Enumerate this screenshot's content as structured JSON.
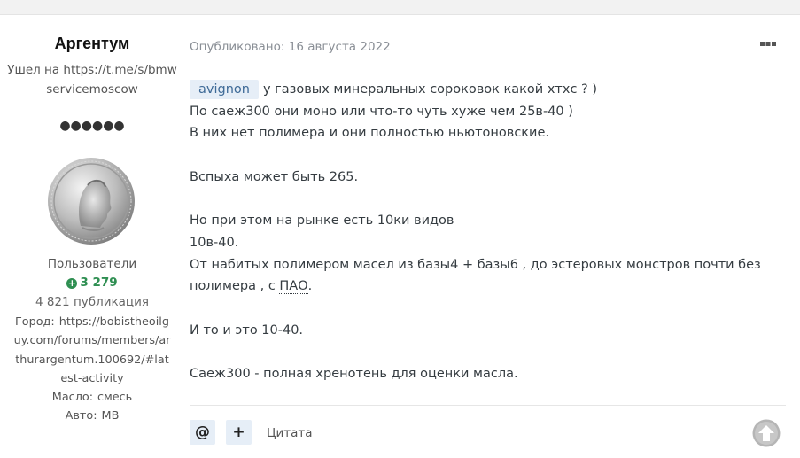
{
  "author": {
    "name": "Аргентум",
    "title": "Ушел на https://t.me/s/bmwservicemoscow",
    "rank_dots": "●●●●●●",
    "group": "Пользователи",
    "reputation": "3 279",
    "posts": "4 821 публикация",
    "fields": [
      {
        "label": "Город:",
        "value": "https://bobistheoilguy.com/forums/members/arthurargentum.100692/#latest-activity"
      },
      {
        "label": "Масло:",
        "value": "смесь"
      },
      {
        "label": "Авто:",
        "value": "MB"
      }
    ]
  },
  "post": {
    "published": "Опубликовано: 16 августа 2022",
    "mention": "avignon",
    "line1": "у газовых минеральных сороковок какой хтхс ? )",
    "line2": "По саеж300 они моно или что-то чуть хуже чем 25в-40 )",
    "line3": "В них нет полимера и они полностью ньютоновские.",
    "line4": "Вспыха может быть 265.",
    "line5": "Но при этом на рынке есть 10ки видов",
    "line6": "10в-40.",
    "line7": "От набитых полимером масел из базы4 + базы6 , до эстеровых монстров почти без",
    "line8_pre": "полимера , с ",
    "line8_abbr": "ПАО",
    "line8_post": ".",
    "line9": "И то и это 10-40.",
    "line10": "Саеж300 - полная хренотень для оценки масла."
  },
  "actions": {
    "mention_glyph": "@",
    "multiquote_glyph": "+",
    "quote_label": "Цитата"
  },
  "colors": {
    "reputation": "#2f8f52",
    "mention_bg": "#e6eef7",
    "mention_text": "#3e6a97"
  },
  "icons": [
    "ellipsis-icon",
    "plus-circle-icon",
    "arrow-up-circle-icon"
  ]
}
